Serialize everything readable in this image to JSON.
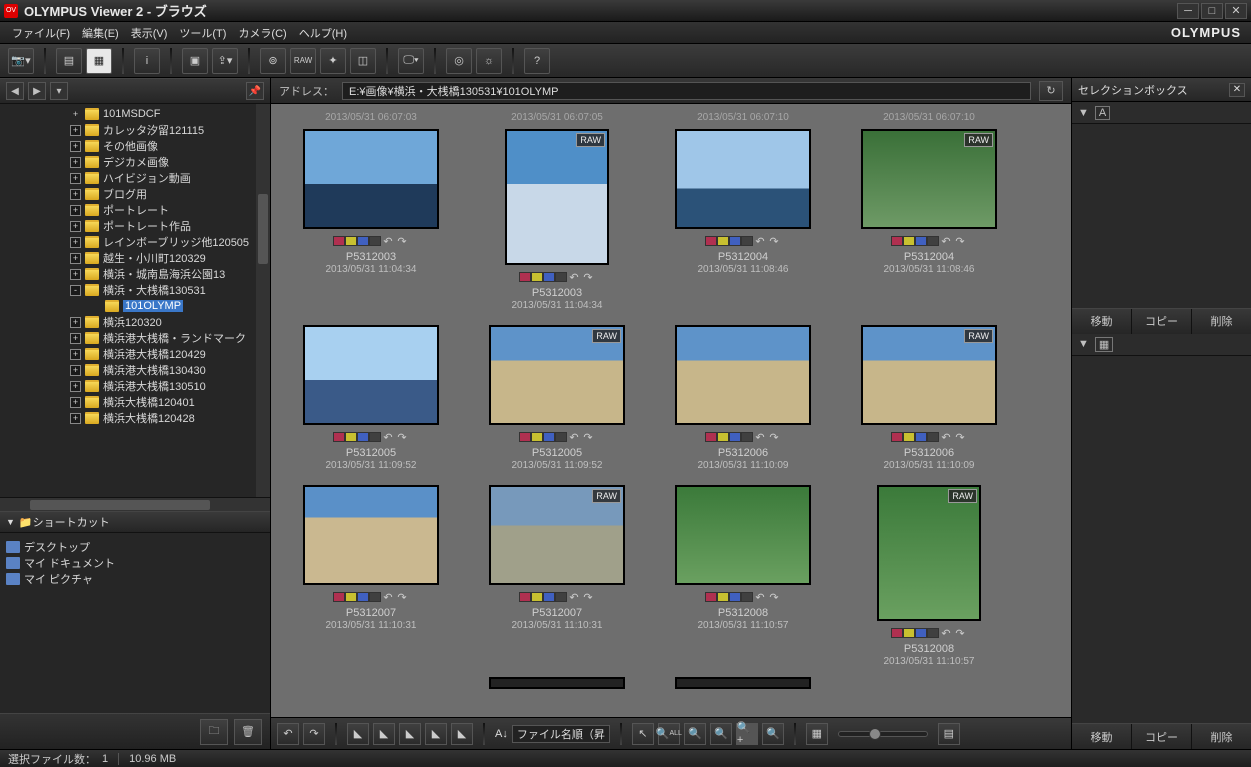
{
  "app": {
    "title": "OLYMPUS Viewer 2 - ブラウズ",
    "brand": "OLYMPUS"
  },
  "menu": {
    "file": "ファイル(F)",
    "edit": "編集(E)",
    "view": "表示(V)",
    "tools": "ツール(T)",
    "camera": "カメラ(C)",
    "help": "ヘルプ(H)"
  },
  "address": {
    "label": "アドレス：",
    "value": "E:¥画像¥横浜・大桟橋130531¥101OLYMP"
  },
  "tree": {
    "items": [
      {
        "exp": "+",
        "label": "101MSDCF",
        "indent": 0,
        "noexp": true
      },
      {
        "exp": "+",
        "label": "カレッタ汐留121115",
        "indent": 0
      },
      {
        "exp": "+",
        "label": "その他画像",
        "indent": 0
      },
      {
        "exp": "+",
        "label": "デジカメ画像",
        "indent": 0
      },
      {
        "exp": "+",
        "label": "ハイビジョン動画",
        "indent": 0
      },
      {
        "exp": "+",
        "label": "ブログ用",
        "indent": 0
      },
      {
        "exp": "+",
        "label": "ポートレート",
        "indent": 0
      },
      {
        "exp": "+",
        "label": "ポートレート作品",
        "indent": 0
      },
      {
        "exp": "+",
        "label": "レインボーブリッジ他120505",
        "indent": 0
      },
      {
        "exp": "+",
        "label": "越生・小川町120329",
        "indent": 0
      },
      {
        "exp": "+",
        "label": "横浜・城南島海浜公園13",
        "indent": 0
      },
      {
        "exp": "-",
        "label": "横浜・大桟橋130531",
        "indent": 0
      },
      {
        "exp": "",
        "label": "101OLYMP",
        "indent": 1,
        "selected": true,
        "noexp": true
      },
      {
        "exp": "+",
        "label": "横浜120320",
        "indent": 0
      },
      {
        "exp": "+",
        "label": "横浜港大桟橋・ランドマーク",
        "indent": 0
      },
      {
        "exp": "+",
        "label": "横浜港大桟橋120429",
        "indent": 0
      },
      {
        "exp": "+",
        "label": "横浜港大桟橋130430",
        "indent": 0
      },
      {
        "exp": "+",
        "label": "横浜港大桟橋130510",
        "indent": 0
      },
      {
        "exp": "+",
        "label": "横浜大桟橋120401",
        "indent": 0
      },
      {
        "exp": "+",
        "label": "横浜大桟橋120428",
        "indent": 0
      }
    ]
  },
  "shortcuts": {
    "title": "ショートカット",
    "items": [
      "デスクトップ",
      "マイ ドキュメント",
      "マイ ピクチャ"
    ]
  },
  "top_dates": [
    "2013/05/31 06:07:03",
    "2013/05/31 06:07:05",
    "2013/05/31 06:07:10",
    "2013/05/31 06:07:10"
  ],
  "thumbs": [
    {
      "name": "P5312003",
      "ts": "2013/05/31 11:04:34",
      "orient": "landscape",
      "raw": false,
      "fill": "linear-gradient(#6fa7d8 55%,#1f3a5a 55%)"
    },
    {
      "name": "P5312003",
      "ts": "2013/05/31 11:04:34",
      "orient": "portrait",
      "raw": true,
      "fill": "linear-gradient(#4f8fc8 40%,#c8d8e8 40%)"
    },
    {
      "name": "P5312004",
      "ts": "2013/05/31 11:08:46",
      "orient": "landscape",
      "raw": false,
      "fill": "linear-gradient(#9fc6e8 60%,#2b5278 60%)"
    },
    {
      "name": "P5312004",
      "ts": "2013/05/31 11:08:46",
      "orient": "landscape",
      "raw": true,
      "fill": "linear-gradient(#3a7038 0%,#6e9a66 100%)"
    },
    {
      "name": "P5312005",
      "ts": "2013/05/31 11:09:52",
      "orient": "landscape",
      "raw": false,
      "fill": "linear-gradient(#a8d0f0 55%,#3a5a88 55%)"
    },
    {
      "name": "P5312005",
      "ts": "2013/05/31 11:09:52",
      "orient": "landscape",
      "raw": true,
      "fill": "linear-gradient(#5e93c9 35%,#c7b68a 35%)"
    },
    {
      "name": "P5312006",
      "ts": "2013/05/31 11:10:09",
      "orient": "landscape",
      "raw": false,
      "fill": "linear-gradient(#5e93c9 35%,#c7b68a 35%)"
    },
    {
      "name": "P5312006",
      "ts": "2013/05/31 11:10:09",
      "orient": "landscape",
      "raw": true,
      "fill": "linear-gradient(#5e93c9 35%,#c7b68a 35%)"
    },
    {
      "name": "P5312007",
      "ts": "2013/05/31 11:10:31",
      "orient": "landscape",
      "raw": false,
      "fill": "linear-gradient(#5a90c8 32%,#cab890 32%)"
    },
    {
      "name": "P5312007",
      "ts": "2013/05/31 11:10:31",
      "orient": "landscape",
      "raw": true,
      "fill": "linear-gradient(#7799bb 40%,#a0a08a 40%)"
    },
    {
      "name": "P5312008",
      "ts": "2013/05/31 11:10:57",
      "orient": "landscape",
      "raw": false,
      "fill": "linear-gradient(#3b7a3a 0%,#6aa060 100%)"
    },
    {
      "name": "P5312008",
      "ts": "2013/05/31 11:10:57",
      "orient": "portrait",
      "raw": true,
      "fill": "linear-gradient(#3b7a3a 0%,#6aa060 100%)"
    }
  ],
  "swatches": [
    "#b03050",
    "#c8c030",
    "#4060c0",
    "#404040"
  ],
  "sort": {
    "prefix": "ファイル名順（昇"
  },
  "selection_box": {
    "title": "セレクションボックス"
  },
  "right_actions": {
    "move": "移動",
    "copy": "コピー",
    "delete": "削除"
  },
  "status": {
    "sel_label": "選択ファイル数：",
    "sel_count": "1",
    "size": "10.96 MB"
  },
  "raw_label": "RAW"
}
